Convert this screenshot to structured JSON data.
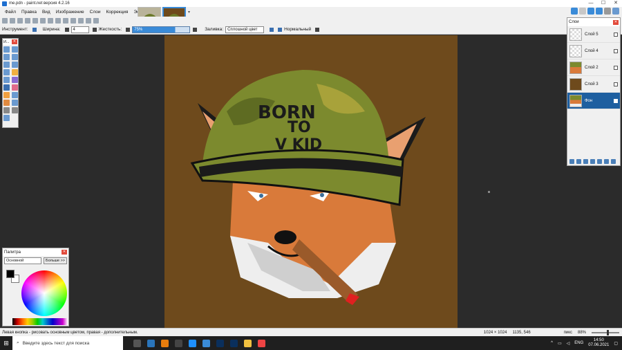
{
  "window": {
    "title": "me.pdn - paint.net версия 4.2.16",
    "minimize": "—",
    "maximize": "☐",
    "close": "✕"
  },
  "menu": {
    "items": [
      "Файл",
      "Правка",
      "Вид",
      "Изображение",
      "Слои",
      "Коррекция",
      "Эффекты"
    ]
  },
  "options": {
    "tool_label": "Инструмент:",
    "width_label": "Ширина:",
    "width_value": "4",
    "hardness_label": "Жесткость:",
    "hardness_value": "75%",
    "fill_label": "Заливка:",
    "fill_value": "Сплошной цвет",
    "blend_value": "Нормальный"
  },
  "tools_window": {
    "title": "И..."
  },
  "palette": {
    "title": "Палитра",
    "mode": "Основной",
    "more_button": "Больше >>"
  },
  "layers": {
    "title": "Слои",
    "items": [
      {
        "name": "Слой 5",
        "checked": true,
        "selected": false
      },
      {
        "name": "Слой 4",
        "checked": true,
        "selected": false
      },
      {
        "name": "Слой 2",
        "checked": true,
        "selected": false
      },
      {
        "name": "Слой 3",
        "checked": true,
        "selected": false
      },
      {
        "name": "Фон",
        "checked": true,
        "selected": true
      }
    ]
  },
  "artwork": {
    "helmet_line1": "BORN",
    "helmet_line2": "TO",
    "helmet_line3": "V KID"
  },
  "status": {
    "hint": "Левая кнопка - рисовать основным цветом, правая - дополнительным.",
    "image_size": "1024 × 1024",
    "cursor_pos": "1135, 546",
    "units": "пикс",
    "zoom": "88%"
  },
  "taskbar": {
    "search_placeholder": "Введите здесь текст для поиска",
    "lang": "ENG",
    "time": "14:50",
    "date": "07.06.2021"
  },
  "colors": {
    "canvas_bg": "#6e4a1c",
    "accent": "#1e5fa0"
  }
}
